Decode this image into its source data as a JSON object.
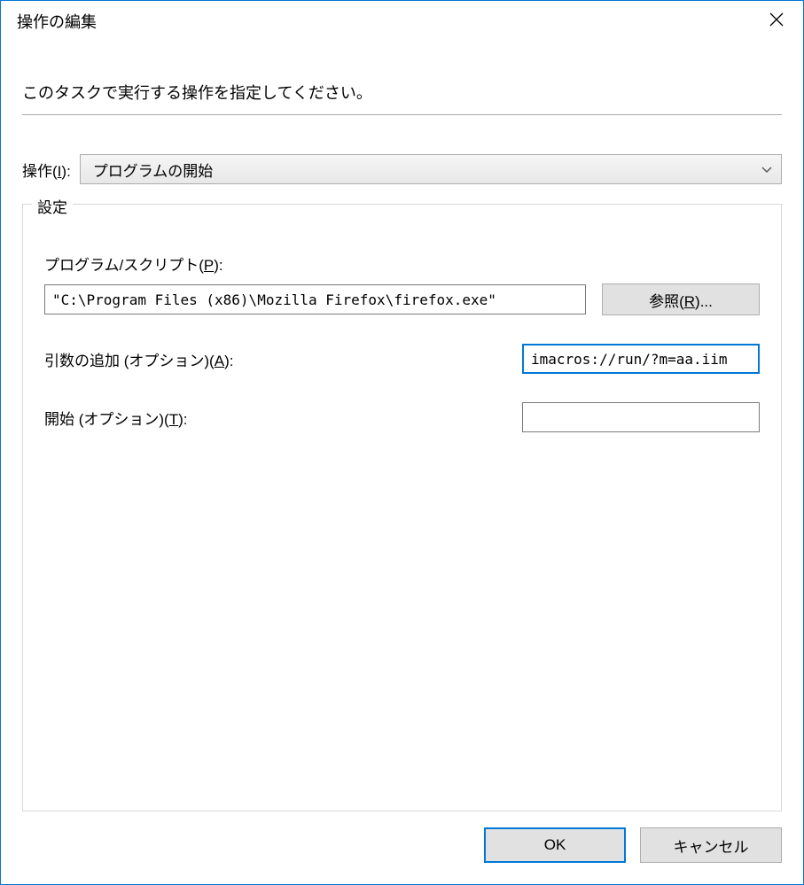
{
  "window": {
    "title": "操作の編集",
    "close_icon": "close-icon"
  },
  "instruction": "このタスクで実行する操作を指定してください。",
  "action": {
    "label_prefix": "操作(",
    "label_key": "I",
    "label_suffix": "):",
    "selected": "プログラムの開始"
  },
  "settings": {
    "legend": "設定",
    "program": {
      "label_prefix": "プログラム/スクリプト(",
      "label_key": "P",
      "label_suffix": "):",
      "value": "\"C:\\Program Files (x86)\\Mozilla Firefox\\firefox.exe\"",
      "browse_prefix": "参照(",
      "browse_key": "R",
      "browse_suffix": ")..."
    },
    "args": {
      "label_prefix": "引数の追加 (オプション)(",
      "label_key": "A",
      "label_suffix": "):",
      "value": "imacros://run/?m=aa.iim"
    },
    "startin": {
      "label_prefix": "開始 (オプション)(",
      "label_key": "T",
      "label_suffix": "):",
      "value": ""
    }
  },
  "footer": {
    "ok": "OK",
    "cancel": "キャンセル"
  }
}
